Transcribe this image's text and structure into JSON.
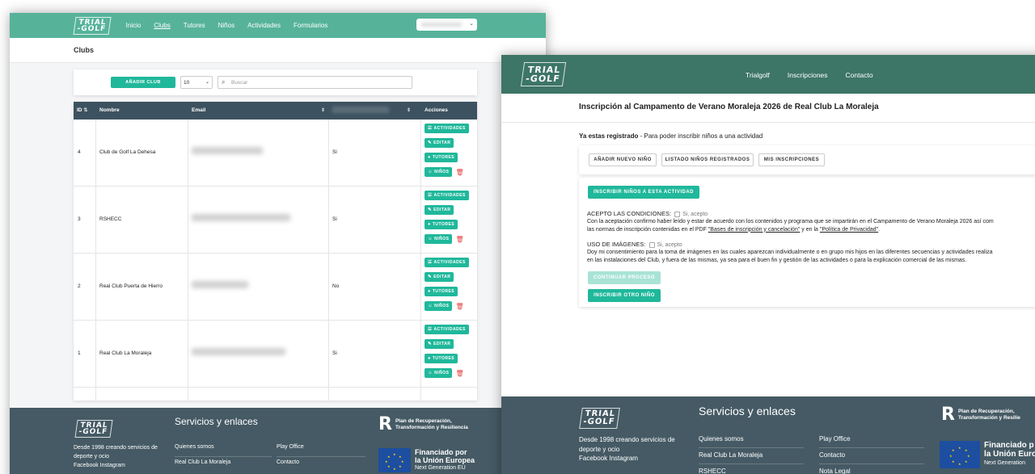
{
  "admin": {
    "logo": {
      "line1": "TRIAL",
      "line2": "-GOLF"
    },
    "nav": [
      {
        "label": "Inicio"
      },
      {
        "label": "Clubs",
        "active": true
      },
      {
        "label": "Tutores"
      },
      {
        "label": "Niños"
      },
      {
        "label": "Actividades"
      },
      {
        "label": "Formularios"
      }
    ],
    "page_title": "Clubs",
    "toolbar": {
      "add_label": "AÑADIR CLUB",
      "page_size": "10",
      "search_placeholder": "Buscar"
    },
    "table": {
      "headers": {
        "id": "ID",
        "name": "Nombre",
        "email": "Email",
        "actions": "Acciones"
      },
      "rows": [
        {
          "id": "4",
          "name": "Club de Golf La Dehesa",
          "flag": "Si"
        },
        {
          "id": "3",
          "name": "RSHECC",
          "flag": "Si"
        },
        {
          "id": "2",
          "name": "Real Club Puerta de Hierro",
          "flag": "No"
        },
        {
          "id": "1",
          "name": "Real Club La Moraleja",
          "flag": "Si"
        }
      ],
      "action_labels": {
        "activities": "ACTIVIDADES",
        "edit": "EDITAR",
        "tutors": "TUTORES",
        "kids": "NIÑOS"
      }
    },
    "footer": {
      "logo": {
        "line1": "TRIAL",
        "line2": "-GOLF"
      },
      "desc": "Desde 1998 creando servicios de deporte y ocio",
      "social": "Facebook Instagram",
      "title": "Servicios y enlaces",
      "links_col1": [
        "Quienes somos",
        "Real Club La Moraleja"
      ],
      "links_col2": [
        "Play Office",
        "Contacto"
      ],
      "prtr": {
        "line1": "Plan de Recuperación,",
        "line2": "Transformación y Resiliencia"
      },
      "eu": {
        "line1": "Financiado por",
        "line2": "la Unión Europea",
        "line3": "Next Generation EU"
      }
    }
  },
  "public": {
    "logo": {
      "line1": "TRIAL",
      "line2": "-GOLF"
    },
    "nav": [
      "Trialgolf",
      "Inscripciones",
      "Contacto"
    ],
    "title": "Inscripción al Campamento de Verano Moraleja 2026 de Real Club La Moraleja",
    "registered": {
      "bold": "Ya estas registrado",
      "rest": " - Para poder inscribir niños a una actividad"
    },
    "buttons": {
      "add_kid": "AÑADIR NUEVO NIÑO",
      "list_kids": "LISTADO NIÑOS REGISTRADOS",
      "my_inscriptions": "MIS INSCRIPCIONES"
    },
    "form": {
      "inscribe_btn": "INSCRIBIR NIÑOS A ESTA ACTIVIDAD",
      "conditions_label": "ACEPTO LAS CONDICIONES:",
      "accept_text": "Si, acepto",
      "conditions_p1": "Con la aceptación confirmo haber leído y estar de acuerdo con los contenidos y programa que se impartirán en el Campamento de Verano Moraleja 2026 así com",
      "conditions_p2_pre": "las normas de inscripción contenidas en el PDF ",
      "conditions_link1": "\"Bases de inscripción y cancelación\"",
      "conditions_mid": " y en la ",
      "conditions_link2": "\"Política de Privacidad\"",
      "conditions_end": ".",
      "images_label": "USO DE IMÁGENES:",
      "images_p1": "Doy mi consentimiento para la toma de imágenes en las cuales aparezcan individualmente o en grupo mis hijos en las diferentes secuencias y actividades realiza",
      "images_p2": "en las instalaciones del Club, y fuera de las mismas, ya sea para el buen fin y gestión de las actividades o para la explicación comercial de las mismas.",
      "continue_btn": "CONTINUAR PROCESO",
      "another_btn": "INSCRIBIR OTRO NIÑO"
    },
    "footer": {
      "logo": {
        "line1": "TRIAL",
        "line2": "-GOLF"
      },
      "desc": "Desde 1998 creando servicios de deporte y ocio",
      "social": "Facebook Instagram",
      "title": "Servicios y enlaces",
      "links_col1": [
        "Quienes somos",
        "Real Club La Moraleja",
        "RSHECC"
      ],
      "links_col2": [
        "Play Office",
        "Contacto",
        "Nota Legal"
      ],
      "prtr": {
        "line1": "Plan de Recuperación,",
        "line2": "Transformación y Resilie"
      },
      "eu": {
        "line1": "Financiado p",
        "line2": "la Unión Euro",
        "line3": "Next Generation"
      }
    }
  }
}
